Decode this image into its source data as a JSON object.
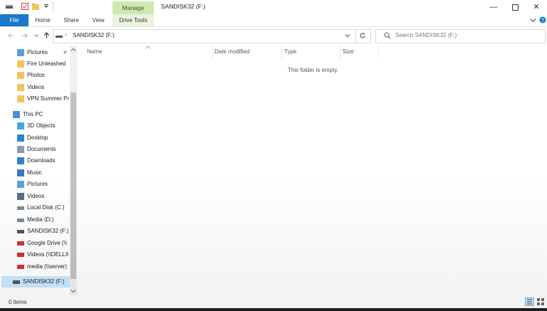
{
  "window": {
    "title": "SANDISK32 (F:)",
    "context_tab_group": "Manage",
    "controls": [
      "minimize",
      "maximize",
      "close"
    ]
  },
  "ribbon": {
    "tabs": [
      {
        "label": "File",
        "active": true
      },
      {
        "label": "Home"
      },
      {
        "label": "Share"
      },
      {
        "label": "View"
      },
      {
        "label": "Drive Tools"
      }
    ]
  },
  "address": {
    "path_label": "SANDISK32 (F:)",
    "search_placeholder": "Search SANDISK32 (F:)"
  },
  "nav": {
    "items": [
      {
        "label": "Pictures",
        "icon": "pictures-icon",
        "pinned": true
      },
      {
        "label": "Fire Unleashed",
        "icon": "folder-icon"
      },
      {
        "label": "Photos",
        "icon": "folder-icon"
      },
      {
        "label": "Videos",
        "icon": "folder-icon"
      },
      {
        "label": "VPN Summer Pr",
        "icon": "folder-icon"
      },
      {
        "label": "This PC",
        "icon": "pc-icon"
      },
      {
        "label": "3D Objects",
        "icon": "cube-icon"
      },
      {
        "label": "Desktop",
        "icon": "desktop-icon"
      },
      {
        "label": "Documents",
        "icon": "documents-icon"
      },
      {
        "label": "Downloads",
        "icon": "download-icon"
      },
      {
        "label": "Music",
        "icon": "music-icon"
      },
      {
        "label": "Pictures",
        "icon": "pictures-icon"
      },
      {
        "label": "Videos",
        "icon": "videos-icon"
      },
      {
        "label": "Local Disk (C:)",
        "icon": "disk-icon"
      },
      {
        "label": "Media (D:)",
        "icon": "disk-icon"
      },
      {
        "label": "SANDISK32 (F:)",
        "icon": "usb-drive-icon"
      },
      {
        "label": "Google Drive (\\\\",
        "icon": "network-drive-icon"
      },
      {
        "label": "Videos (\\\\DELLX",
        "icon": "network-drive-icon"
      },
      {
        "label": "media (\\\\server)",
        "icon": "network-drive-icon"
      },
      {
        "label": "SANDISK32 (F:)",
        "icon": "usb-drive-icon",
        "selected": true
      }
    ]
  },
  "columns": [
    "Name",
    "Date modified",
    "Type",
    "Size"
  ],
  "content": {
    "empty_message": "This folder is empty."
  },
  "status": {
    "item_count": "0 items"
  },
  "colors": {
    "accent": "#1979ca",
    "manage_tab": "#cfe8b0",
    "selection": "#cce8ff"
  }
}
